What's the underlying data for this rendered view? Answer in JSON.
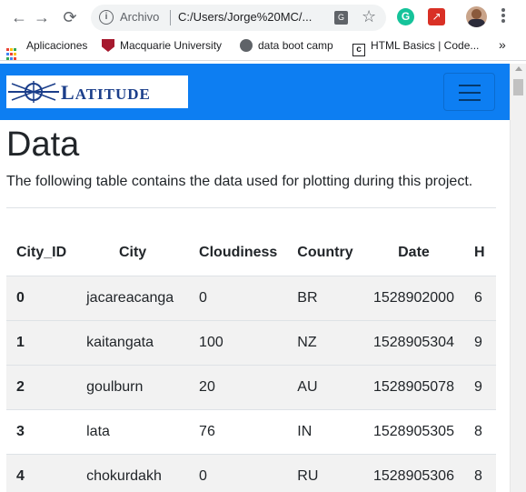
{
  "browser": {
    "address_prefix": "Archivo",
    "url": "C:/Users/Jorge%20MC/...",
    "bookmarks": [
      {
        "label": "Aplicaciones"
      },
      {
        "label": "Macquarie University"
      },
      {
        "label": "data boot camp"
      },
      {
        "label": "HTML Basics | Code..."
      }
    ],
    "more_bookmarks": "»"
  },
  "navbar": {
    "brand_first": "L",
    "brand_rest": "ATITUDE"
  },
  "page": {
    "title": "Data",
    "description": "The following table contains the data used for plotting during this project."
  },
  "table": {
    "headers": [
      "City_ID",
      "City",
      "Cloudiness",
      "Country",
      "Date",
      "H"
    ],
    "rows": [
      [
        "0",
        "jacareacanga",
        "0",
        "BR",
        "1528902000",
        "6"
      ],
      [
        "1",
        "kaitangata",
        "100",
        "NZ",
        "1528905304",
        "9"
      ],
      [
        "2",
        "goulburn",
        "20",
        "AU",
        "1528905078",
        "9"
      ],
      [
        "3",
        "lata",
        "76",
        "IN",
        "1528905305",
        "8"
      ],
      [
        "4",
        "chokurdakh",
        "0",
        "RU",
        "1528905306",
        "8"
      ]
    ]
  },
  "colors": {
    "navbar": "#0d7ef2",
    "brand_text": "#1b3e8a",
    "row_stripe": "#f2f2f2"
  }
}
